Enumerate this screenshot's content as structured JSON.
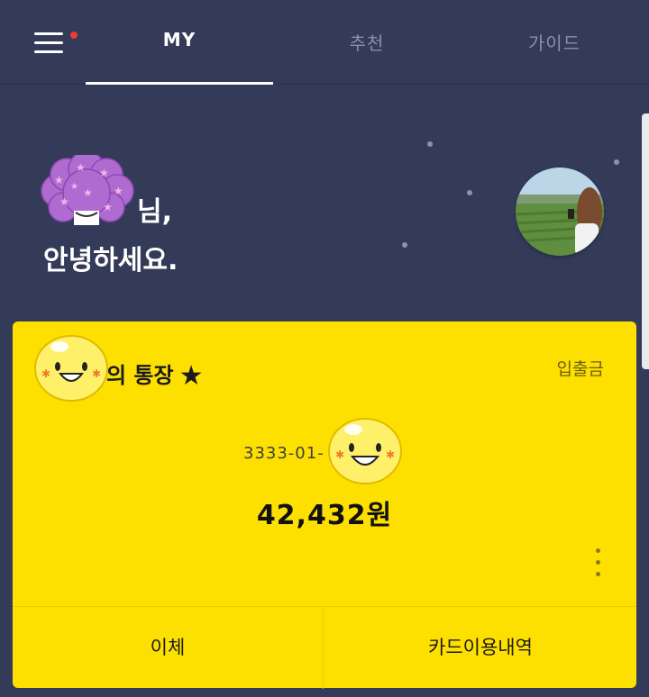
{
  "topbar": {
    "menu_icon": "hamburger-menu-icon",
    "notification_color": "#ee3b2f",
    "tabs": [
      {
        "label": "MY",
        "active": true
      },
      {
        "label": "추천",
        "active": false
      },
      {
        "label": "가이드",
        "active": false
      }
    ]
  },
  "greeting": {
    "line1": "님,",
    "line2": "안녕하세요."
  },
  "account": {
    "title": "의 통장",
    "favorite_star": "★",
    "history_link": "입출금",
    "number": "3333-01-",
    "balance": "42,432원",
    "actions": {
      "transfer": "이체",
      "card_history": "카드이용내역"
    }
  },
  "colors": {
    "background": "#333b58",
    "card": "#fee000",
    "accent_dot": "#ee3b2f"
  }
}
